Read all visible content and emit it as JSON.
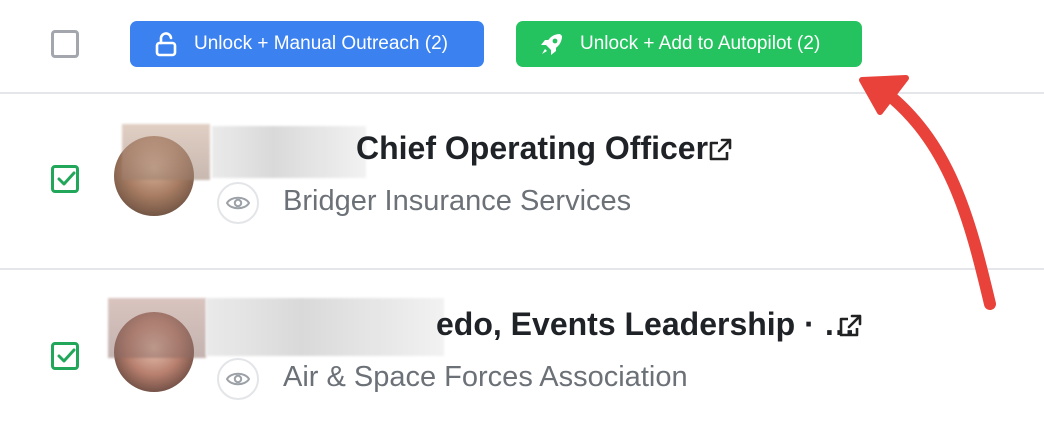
{
  "toolbar": {
    "manual_outreach_label": "Unlock + Manual Outreach (2)",
    "autopilot_label": "Unlock + Add to Autopilot (2)",
    "manual_color": "#3b82f0",
    "autopilot_color": "#24c35f"
  },
  "rows": [
    {
      "name_visible": "Chief Operating Officer",
      "company": "Bridger Insurance Services",
      "selected": true
    },
    {
      "name_visible": "edo, Events Leadership · …",
      "company": "Air & Space Forces Association",
      "selected": true
    }
  ],
  "icons": {
    "manual": "lock-open-icon",
    "autopilot": "rocket-icon",
    "view": "eye-icon",
    "external": "external-link-icon",
    "annotation": "red-arrow"
  },
  "colors": {
    "check": "#22a75a",
    "annotation_arrow": "#e8423b"
  }
}
